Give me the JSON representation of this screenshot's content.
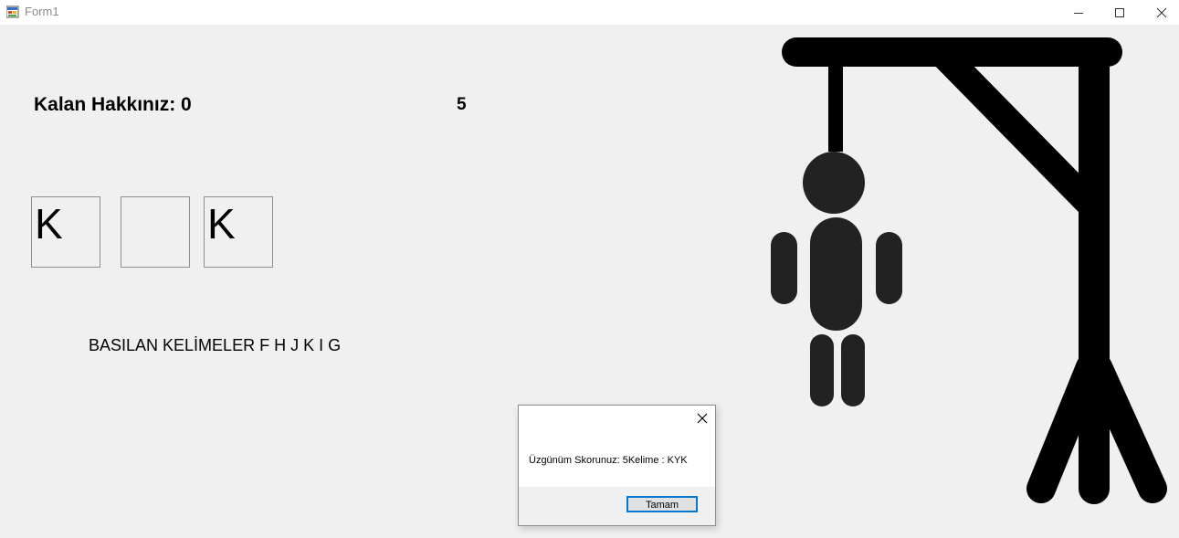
{
  "window": {
    "title": "Form1"
  },
  "game": {
    "remaining_label": "Kalan Hakkınız: 0",
    "score": "5",
    "letters": [
      "K",
      "",
      "K"
    ],
    "pressed_label": "BASILAN KELİMELER F H J K I G"
  },
  "dialog": {
    "message": "Üzgünüm Skorunuz: 5Kelime : KYK",
    "ok_label": "Tamam"
  },
  "colors": {
    "figure": "#222222",
    "gallows": "#000000",
    "button_border": "#0078d7",
    "background": "#f0f0f0"
  },
  "icons": {
    "app": "app-icon",
    "minimize": "minimize-icon",
    "maximize": "maximize-icon",
    "close": "close-icon",
    "dialog_close": "close-icon"
  }
}
